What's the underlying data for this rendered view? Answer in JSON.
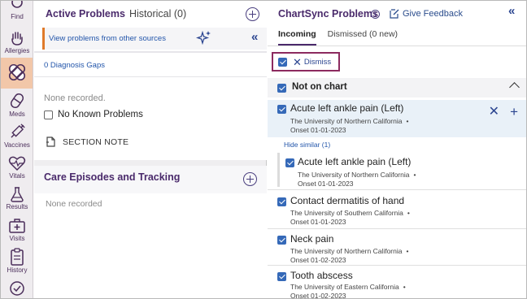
{
  "nav": {
    "items": [
      {
        "label": "Find",
        "icon": "search-icon"
      },
      {
        "label": "Allergies",
        "icon": "hand-icon"
      },
      {
        "label": "",
        "icon": "bandage-icon",
        "active": true
      },
      {
        "label": "Meds",
        "icon": "pill-icon"
      },
      {
        "label": "Vaccines",
        "icon": "syringe-icon"
      },
      {
        "label": "Vitals",
        "icon": "heart-pulse-icon"
      },
      {
        "label": "Results",
        "icon": "flask-icon"
      },
      {
        "label": "Visits",
        "icon": "medical-bag-icon"
      },
      {
        "label": "History",
        "icon": "clipboard-icon"
      },
      {
        "label": "",
        "icon": "badge-check-icon"
      }
    ],
    "active_color": "#f2c7a9"
  },
  "problems": {
    "tab_active": "Active Problems",
    "tab_historical": "Historical (0)",
    "banner_link": "View problems from other sources",
    "gaps_link": "0 Diagnosis Gaps",
    "none_recorded": "None recorded.",
    "no_known_label": "No Known Problems",
    "section_note": "SECTION NOTE"
  },
  "care": {
    "title": "Care Episodes and Tracking",
    "none_recorded": "None recorded"
  },
  "chartsync": {
    "title": "ChartSync Problems",
    "feedback": "Give Feedback",
    "tab_incoming": "Incoming",
    "tab_dismissed": "Dismissed (0 new)",
    "dismiss_label": "Dismiss",
    "group_label": "Not on chart",
    "hide_similar": "Hide similar (1)",
    "items": [
      {
        "name": "Acute left ankle pain (Left)",
        "source": "The University of Northern California",
        "onset": "Onset 01-01-2023"
      },
      {
        "name": "Acute left ankle pain (Left)",
        "source": "The University of Northern California",
        "onset": "Onset 01-01-2023"
      },
      {
        "name": "Contact dermatitis of hand",
        "source": "The University of Southern California",
        "onset": "Onset 01-01-2023"
      },
      {
        "name": "Neck pain",
        "source": "The University of Northern California",
        "onset": "Onset 01-02-2023"
      },
      {
        "name": "Tooth abscess",
        "source": "The University of Eastern California",
        "onset": "Onset 01-02-2023"
      }
    ],
    "bullet": "•"
  },
  "colors": {
    "brand_purple": "#4a2a6b",
    "link_blue": "#2255aa",
    "checkbox_blue": "#3569b8",
    "highlight_border": "#8c2a5f",
    "banner_accent": "#e07a2a"
  }
}
